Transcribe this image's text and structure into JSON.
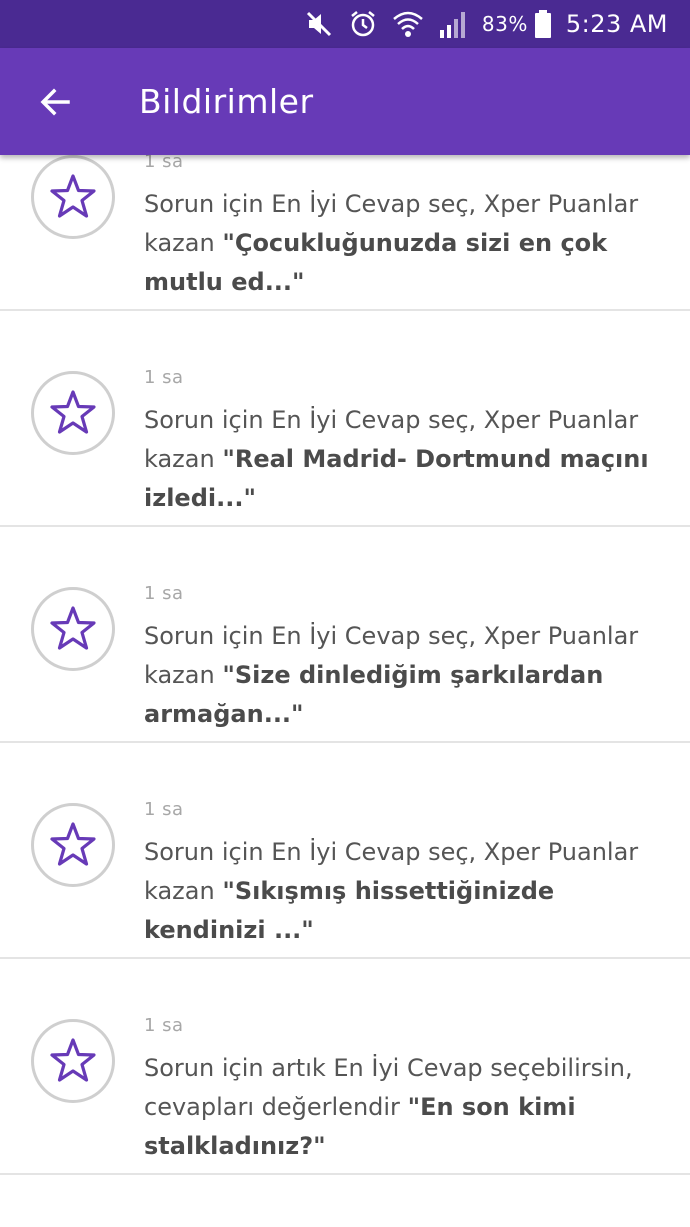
{
  "status_bar": {
    "battery": "83%",
    "time": "5:23 AM"
  },
  "app_bar": {
    "title": "Bildirimler"
  },
  "notifications": [
    {
      "time": "1 sa",
      "prefix": "Sorun için En İyi Cevap seç, Xper Puanlar kazan ",
      "quote": "\"Çocukluğunuzda sizi en çok mutlu ed...\""
    },
    {
      "time": "1 sa",
      "prefix": "Sorun için En İyi Cevap seç, Xper Puanlar kazan ",
      "quote": "\"Real Madrid- Dortmund maçını izledi...\""
    },
    {
      "time": "1 sa",
      "prefix": "Sorun için En İyi Cevap seç, Xper Puanlar kazan ",
      "quote": "\"Size dinlediğim şarkılardan armağan...\""
    },
    {
      "time": "1 sa",
      "prefix": "Sorun için En İyi Cevap seç, Xper Puanlar kazan ",
      "quote": "\"Sıkışmış hissettiğinizde kendinizi ...\""
    },
    {
      "time": "1 sa",
      "prefix": "Sorun için artık En İyi Cevap seçebilirsin, cevapları değerlendir ",
      "quote": "\"En son kimi stalkladınız?\""
    }
  ],
  "icons": {
    "notification_icon": "star-icon",
    "back": "arrow-left-icon"
  },
  "colors": {
    "status_bar": "#4a2a92",
    "app_bar": "#673ab7",
    "star": "#673ab7"
  }
}
